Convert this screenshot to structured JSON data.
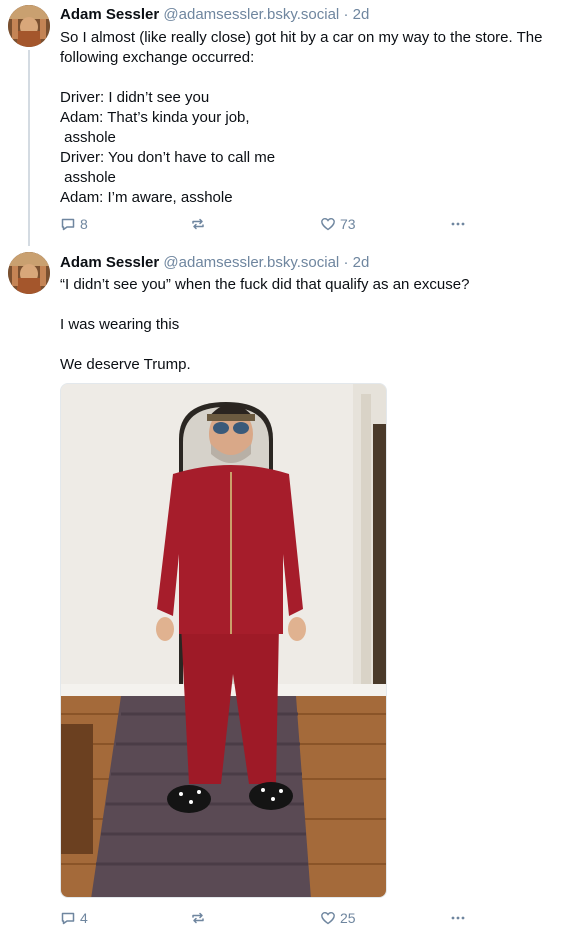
{
  "posts": [
    {
      "author": "Adam Sessler",
      "handle": "@adamsessler.bsky.social",
      "separator": "·",
      "time": "2d",
      "paragraphs": [
        "So I almost (like really close) got hit by a car on my way to the store. The following exchange occurred:",
        "Driver: I didn’t see you\nAdam: That’s kinda your job,\n asshole\nDriver: You don’t have to call me\n asshole\nAdam: I’m aware, asshole"
      ],
      "replies": "8",
      "likes": "73"
    },
    {
      "author": "Adam Sessler",
      "handle": "@adamsessler.bsky.social",
      "separator": "·",
      "time": "2d",
      "paragraphs": [
        "“I didn’t see you” when the fuck did that qualify as an excuse?",
        "I was wearing this",
        "We deserve Trump."
      ],
      "replies": "4",
      "likes": "25"
    }
  ],
  "icons": {
    "reply": "speech-bubble-icon",
    "repost": "repost-arrows-icon",
    "like": "heart-icon",
    "more": "ellipsis-icon"
  },
  "colors": {
    "muted": "#6f869f",
    "text": "#0b0f14",
    "tracksuit": "#9e1a27"
  }
}
